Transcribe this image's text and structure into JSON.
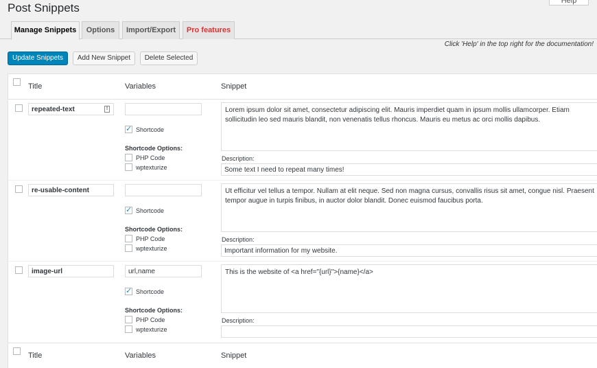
{
  "help_tab": "Help",
  "page_title": "Post Snippets",
  "tabs": [
    {
      "label": "Manage Snippets"
    },
    {
      "label": "Options"
    },
    {
      "label": "Import/Export"
    },
    {
      "label": "Pro features"
    }
  ],
  "doc_note": "Click 'Help' in the top right for the documentation!",
  "buttons": {
    "update": "Update Snippets",
    "add_new": "Add New Snippet",
    "delete_selected": "Delete Selected"
  },
  "columns": {
    "title": "Title",
    "variables": "Variables",
    "snippet": "Snippet"
  },
  "labels": {
    "shortcode": "Shortcode",
    "shortcode_options": "Shortcode Options:",
    "php_code": "PHP Code",
    "wptexturize": "wptexturize",
    "description": "Description:"
  },
  "snippets": [
    {
      "title": "repeated-text",
      "variables": "",
      "snippet": "Lorem ipsum dolor sit amet, consectetur adipiscing elit. Mauris imperdiet quam in ipsum mollis ullamcorper. Etiam sollicitudin leo sed mauris blandit, non venenatis tellus rhoncus. Mauris eu metus ac orci mollis dapibus.",
      "description": "Some text I need to repeat many times!",
      "shortcode": true,
      "php_code": false,
      "wptexturize": false
    },
    {
      "title": "re-usable-content",
      "variables": "",
      "snippet": "Ut efficitur vel tellus a tempor. Nullam at elit neque. Sed non magna cursus, convallis risus sit amet, congue nisl. Praesent tempor augue in turpis finibus, in auctor dolor blandit. Donec euismod faucibus porta.",
      "description": "Important information for my website.",
      "shortcode": true,
      "php_code": false,
      "wptexturize": false
    },
    {
      "title": "image-url",
      "variables": "url,name",
      "snippet": "This is the website of <a href=\"{url}\">{name}</a>",
      "description": "",
      "shortcode": true,
      "php_code": false,
      "wptexturize": false
    }
  ]
}
